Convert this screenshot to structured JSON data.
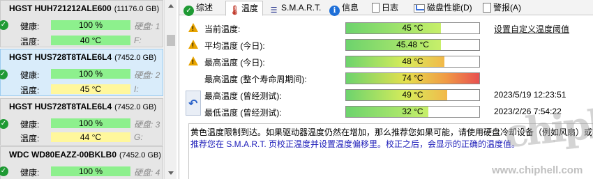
{
  "disks": [
    {
      "name": "HGST HUH721212ALE600",
      "capacity": "(11176.0 GB)",
      "health_label": "健康:",
      "health": "100 %",
      "temp_label": "温度:",
      "temp": "40 °C",
      "disk_note": "硬盘: 1",
      "drive": "F:"
    },
    {
      "name": "HGST HUS728T8TALE6L4",
      "capacity": "(7452.0 GB)",
      "health_label": "健康:",
      "health": "100 %",
      "temp_label": "温度:",
      "temp": "45 °C",
      "disk_note": "硬盘: 2",
      "drive": "I:"
    },
    {
      "name": "HGST HUS728T8TALE6L4",
      "capacity": "(7452.0 GB)",
      "health_label": "健康:",
      "health": "100 %",
      "temp_label": "温度:",
      "temp": "44 °C",
      "disk_note": "硬盘: 3",
      "drive": "G:"
    },
    {
      "name": "WDC WD80EAZZ-00BKLB0",
      "capacity": "(7452.0 GB)",
      "health_label": "健康:",
      "health": "100 %",
      "temp_label": "",
      "temp": "",
      "disk_note": "硬盘: 4",
      "drive": ""
    }
  ],
  "tabs": [
    "综述",
    "温度",
    "S.M.A.R.T.",
    "信息",
    "日志",
    "磁盘性能(D)",
    "警报(A)"
  ],
  "temperature": {
    "rows": [
      {
        "label": "当前温度:",
        "value": "45 °C",
        "fill": 0.71,
        "extra": "设置自定义温度阈值",
        "warn": true
      },
      {
        "label": "平均温度 (今日):",
        "value": "45.48 °C",
        "fill": 0.71,
        "extra": "",
        "warn": true
      },
      {
        "label": "最高温度 (今日):",
        "value": "48 °C",
        "fill": 0.74,
        "extra": "",
        "warn": true
      },
      {
        "label": "最高温度 (整个寿命周期间):",
        "value": "74 °C",
        "fill": 1.0,
        "extra": "",
        "warn": false
      },
      {
        "label": "最高温度 (曾经测试):",
        "value": "49 °C",
        "fill": 0.76,
        "extra": "2023/5/19 12:23:51",
        "warn": false
      },
      {
        "label": "最低温度 (曾经测试):",
        "value": "32 °C",
        "fill": 0.62,
        "extra": "2023/2/26 7:54:22",
        "warn": false
      }
    ]
  },
  "message": {
    "line1": "黄色温度限制到达。如果驱动器温度仍然在增加，那么推荐您如果可能，请使用硬盘冷却设备（例如风扇）或被动",
    "line2": "推荐您在 S.M.A.R.T. 页校正温度并设置温度偏移里。校正之后，会显示的正确的温度值。"
  },
  "watermark": {
    "logo": "chip hell",
    "url": "www.chiphell.com"
  },
  "colors": {
    "health_bar": "#8df08d",
    "temp_bar_yellow": "#fff79c",
    "ok_icon": "#1f9a34",
    "selected_card": "#d9ecfa",
    "warning": "#e8a400",
    "message_blue": "#1a1ab8"
  }
}
